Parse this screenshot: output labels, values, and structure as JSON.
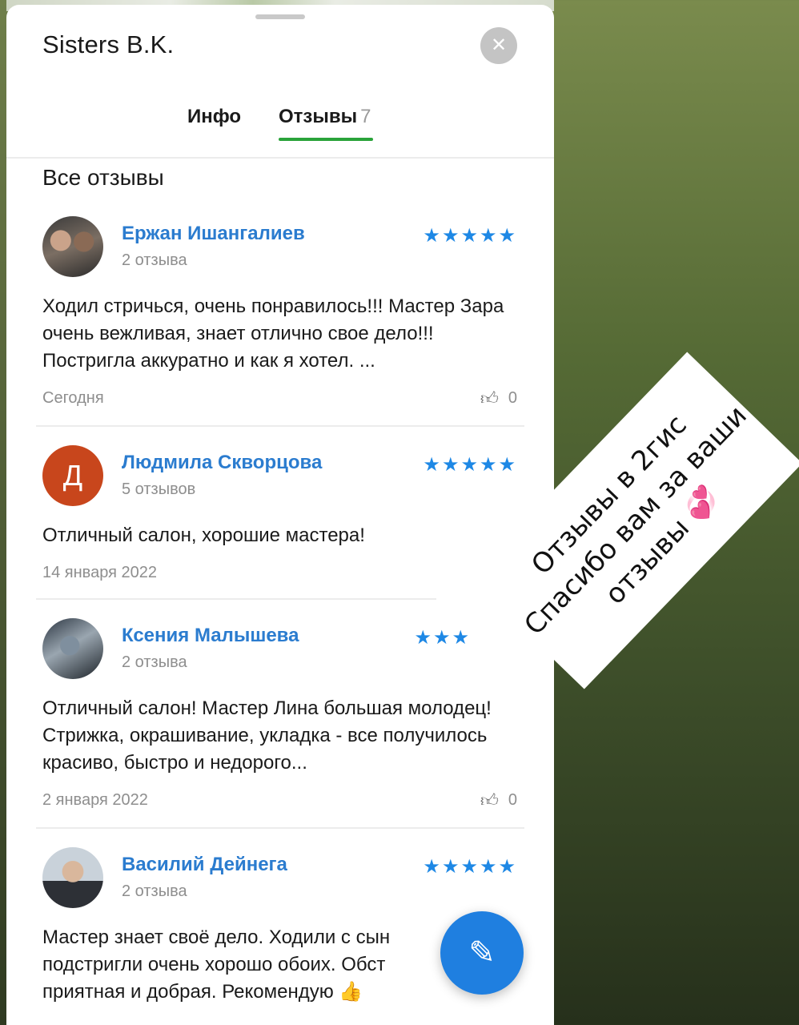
{
  "header": {
    "title": "Sisters B.K.",
    "close_icon": "close-icon"
  },
  "tabs": [
    {
      "label": "Инфо",
      "active": false
    },
    {
      "label": "Отзывы",
      "count": "7",
      "active": true
    }
  ],
  "section_title": "Все отзывы",
  "reviews": [
    {
      "name": "Ержан Ишангалиев",
      "meta": "2 отзыва",
      "stars": "★★★★★",
      "text": "Ходил стричься, очень понравилось!!! Мастер Зара очень вежливая, знает отлично свое дело!!! Постригла аккуратно и как я хотел. ...",
      "date": "Сегодня",
      "likes": "0"
    },
    {
      "name": "Людмила Скворцова",
      "avatar_letter": "Д",
      "meta": "5 отзывов",
      "stars": "★★★★★",
      "text": "Отличный салон, хорошие мастера!",
      "date": "14 января 2022"
    },
    {
      "name": "Ксения Малышева",
      "meta": "2 отзыва",
      "stars": "★★★",
      "text": "Отличный салон! Мастер Лина большая молодец! Стрижка, окрашивание, укладка - все получилось красиво, быстро и недорого...",
      "date": "2 января 2022",
      "likes": "0"
    },
    {
      "name": "Василий Дейнега",
      "meta": "2 отзыва",
      "stars": "★★★★★",
      "text": "Мастер знает своё дело. Ходили с сын подстригли очень хорошо обоих. Обст приятная и добрая. Рекомендую 👍"
    }
  ],
  "fab_icon": "pencil-icon",
  "sticker": {
    "line1": "Отзывы в 2гис",
    "line2": "Спасибо вам за ваши",
    "line3": "отзывы",
    "emoji": "💞"
  },
  "colors": {
    "accent_blue": "#2b7ccf",
    "star_blue": "#1e88e5",
    "tab_green": "#2aa33a",
    "fab_blue": "#1f7fe0",
    "avatar_orange": "#c8461c"
  }
}
